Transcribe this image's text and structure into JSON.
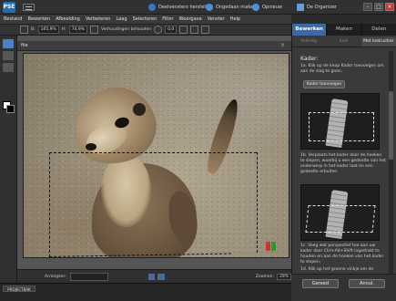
{
  "app": {
    "logo_text": "PSE"
  },
  "titlebar": {
    "revert_label": "Deelvensters herstellen",
    "undo_label": "Ongedaan maken",
    "redo_label": "Opnieuw",
    "organizer_label": "De Organizer"
  },
  "window_controls": {
    "minimize": "–",
    "maximize": "□",
    "close": "×"
  },
  "menu": [
    "Bestand",
    "Bewerken",
    "Afbeelding",
    "Verbeteren",
    "Laag",
    "Selecteren",
    "Filter",
    "Weergave",
    "Venster",
    "Help"
  ],
  "options": {
    "width_label": "B:",
    "width_value": "165,9%",
    "height_label": "H:",
    "height_value": "74,9%",
    "constrain_label": "Verhoudingen behouden",
    "angle_value": "0,0"
  },
  "right_tabs": [
    {
      "label": "Bewerken",
      "active": true
    },
    {
      "label": "Maken",
      "active": false
    },
    {
      "label": "Delen",
      "active": false
    }
  ],
  "right_subtabs": [
    {
      "label": "Volledig",
      "active": false
    },
    {
      "label": "Snel",
      "active": false
    },
    {
      "label": "Met instructies",
      "active": true
    }
  ],
  "document": {
    "tab_label": "file",
    "close_glyph": "×"
  },
  "guide": {
    "title": "Kader:",
    "step1": "1a. Klik op de knop Kader toevoegen om aan de slag te gaan.",
    "button_label": "Kader toevoegen",
    "step2": "1b. Verplaats het kader door de hoeken te slepen, waarbij u een gedeelte van het onderwerp in het kader laat en een gedeelte erbuiten.",
    "step3": "1c. Voeg wat perspectief toe aan uw kader door Ctrl+Alt+Shift ingedrukt te houden en aan de hoeken van het kader te slepen.",
    "step4": "1d. Klik op het groene vinkje om de"
  },
  "status": {
    "arrange_label": "Arrangeer:",
    "zoom_label": "Zoomen:",
    "zoom_value": "28%"
  },
  "project_bin": {
    "label": "PROJECTBAK"
  },
  "panel_buttons": {
    "done": "Gereed",
    "cancel": "Annul."
  },
  "colors": {
    "accent": "#3c6aa8",
    "toolbar_bg": "#303030",
    "photo_sand": "#a89d88",
    "crop_commit": "#3a8f3a",
    "crop_cancel": "#c03a35"
  },
  "icons": {
    "revert": "refresh-icon",
    "undo": "undo-arrow-icon",
    "redo": "redo-arrow-icon",
    "organizer": "grid-organizer-icon"
  }
}
